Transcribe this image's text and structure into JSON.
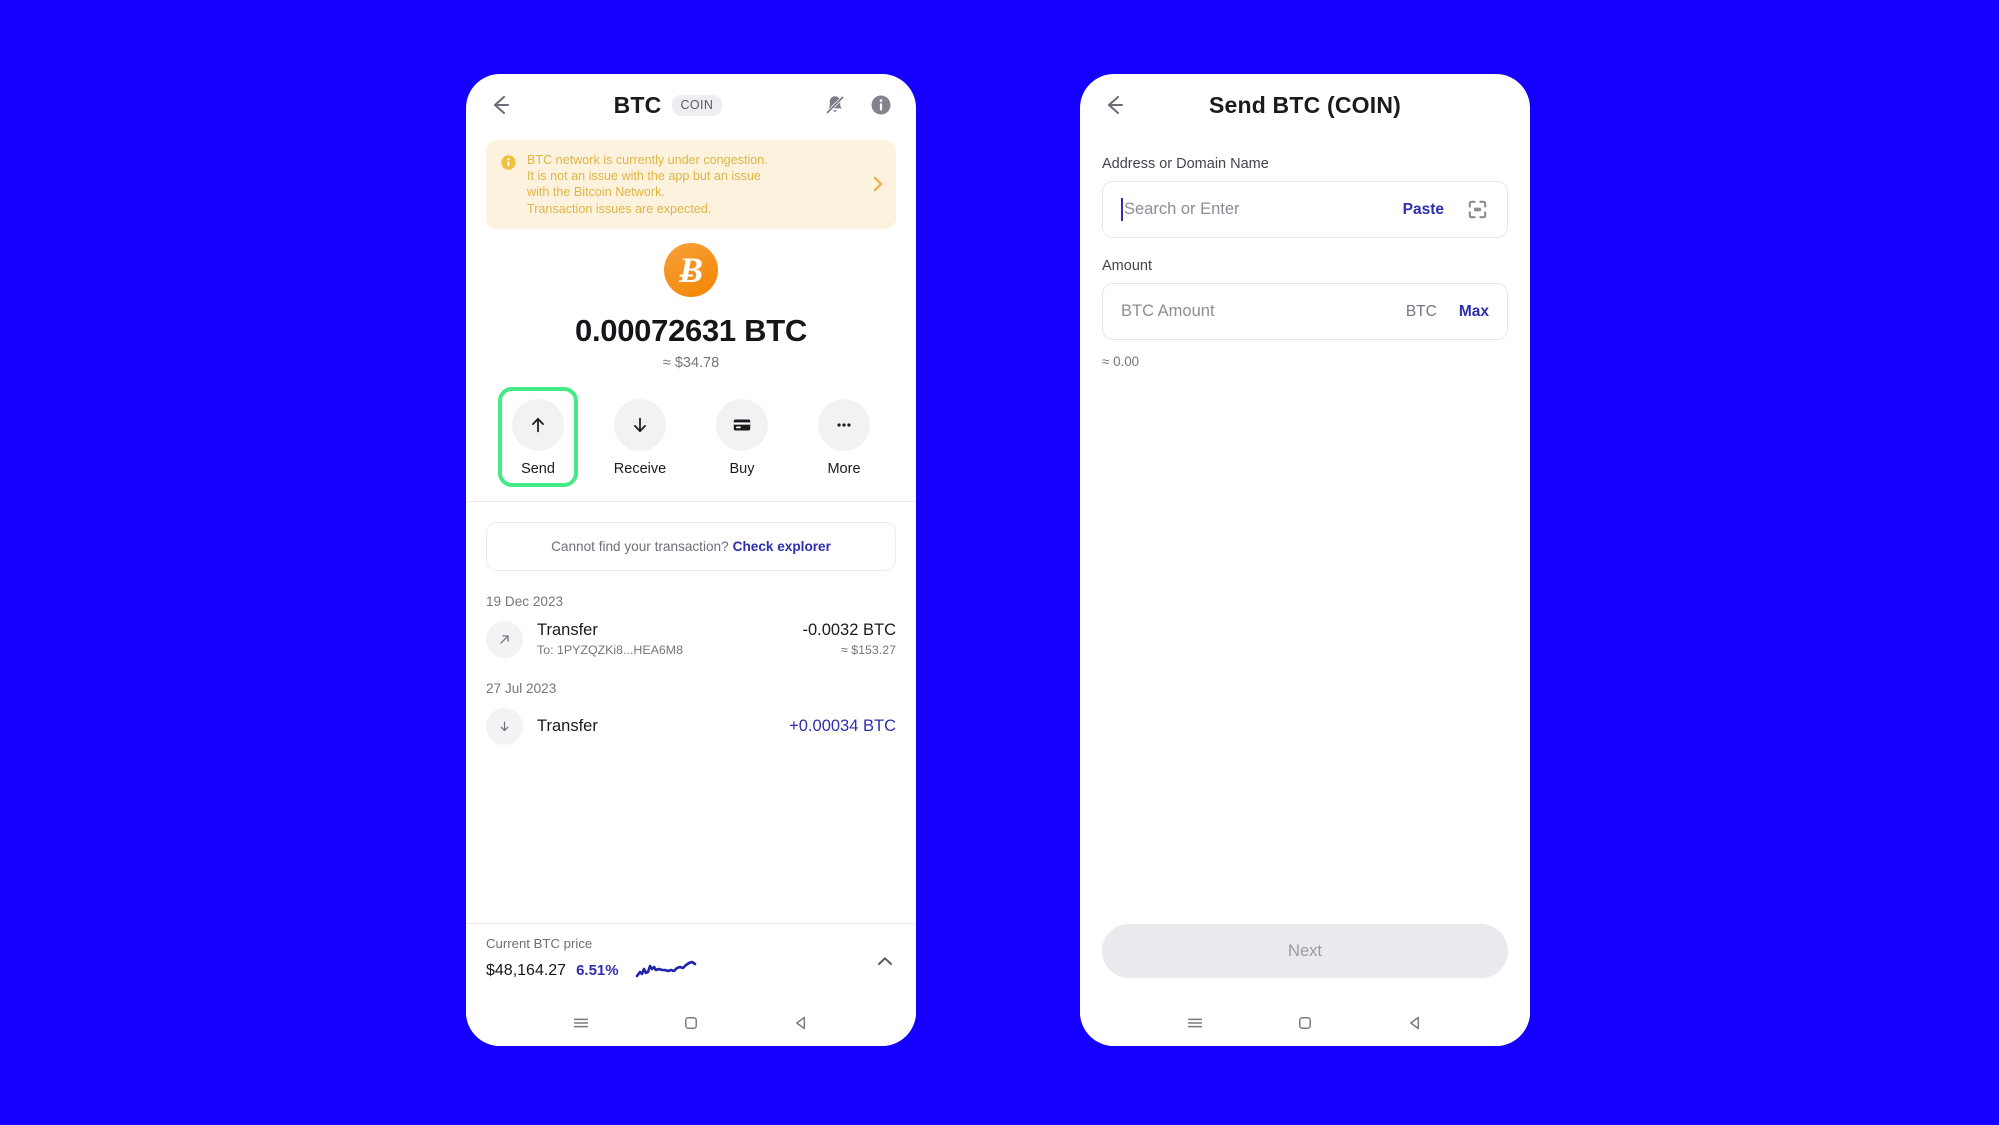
{
  "background_color": "#1500FF",
  "phone_left": {
    "appbar": {
      "back_icon": "back-arrow-icon",
      "title": "BTC",
      "chip": "COIN",
      "notification_icon": "bell-off-icon",
      "info_icon": "info-icon"
    },
    "banner": {
      "icon": "info-circle-icon",
      "text": "BTC network is currently under congestion.\nIt is not an issue with the app but an issue\nwith the Bitcoin Network.\nTransaction issues are expected.",
      "chevron": "chevron-right-icon",
      "bg_color": "#FDF2DD",
      "text_color": "#E0B546"
    },
    "balance": {
      "coin_symbol": "Ƀ",
      "amount": "0.00072631 BTC",
      "fiat": "≈ $34.78"
    },
    "actions": [
      {
        "label": "Send",
        "icon": "arrow-up-icon",
        "highlighted": true
      },
      {
        "label": "Receive",
        "icon": "arrow-down-icon",
        "highlighted": false
      },
      {
        "label": "Buy",
        "icon": "credit-card-icon",
        "highlighted": false
      },
      {
        "label": "More",
        "icon": "ellipsis-icon",
        "highlighted": false
      }
    ],
    "highlight_color": "#45EA87",
    "explorer": {
      "text": "Cannot find your transaction?",
      "link": "Check explorer"
    },
    "transactions": [
      {
        "date": "19 Dec 2023",
        "icon": "arrow-up-right-icon",
        "title": "Transfer",
        "subtitle": "To: 1PYZQZKi8...HEA6M8",
        "value": "-0.0032 BTC",
        "fiat": "≈ $153.27",
        "positive": false
      },
      {
        "date": "27 Jul 2023",
        "icon": "arrow-down-icon",
        "title": "Transfer",
        "subtitle": "",
        "value": "+0.00034 BTC",
        "fiat": "",
        "positive": true
      }
    ],
    "price_bar": {
      "label": "Current BTC price",
      "price": "$48,164.27",
      "change": "6.51%",
      "chevron": "chevron-up-icon",
      "line_color": "#2222A8"
    },
    "navbar": {
      "recents": "menu-icon",
      "home": "home-square-icon",
      "back": "back-triangle-icon"
    }
  },
  "phone_right": {
    "appbar": {
      "back_icon": "back-arrow-icon",
      "title": "Send BTC (COIN)"
    },
    "address": {
      "label": "Address or Domain Name",
      "placeholder": "Search or Enter",
      "value": "",
      "paste_label": "Paste",
      "scan_icon": "qr-scan-icon"
    },
    "amount": {
      "label": "Amount",
      "placeholder": "BTC Amount",
      "value": "",
      "unit": "BTC",
      "max_label": "Max",
      "approx": "≈ 0.00"
    },
    "next_label": "Next",
    "navbar": {
      "recents": "menu-icon",
      "home": "home-square-icon",
      "back": "back-triangle-icon"
    }
  }
}
